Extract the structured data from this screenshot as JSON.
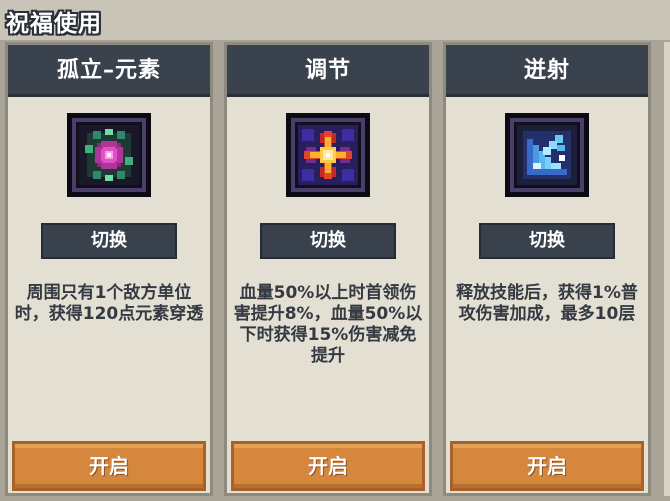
{
  "header": {
    "title": "祝福使用"
  },
  "cards": [
    {
      "title": "孤立–元素",
      "icon": "green-magenta-orb-icon",
      "switch_label": "切换",
      "description": "周围只有1个敌方单位时，获得120点元素穿透",
      "open_label": "开启"
    },
    {
      "title": "调节",
      "icon": "golden-star-burst-icon",
      "switch_label": "切换",
      "description": "血量50%以上时首领伤害提升8%，血量50%以下时获得15%伤害减免提升",
      "open_label": "开启"
    },
    {
      "title": "迸射",
      "icon": "cyan-shard-icon",
      "switch_label": "切换",
      "description": "释放技能后，获得1%普攻伤害加成，最多10层",
      "open_label": "开启"
    }
  ],
  "colors": {
    "panel_bg": "#e4dfd3",
    "header_bar": "#39424d",
    "open_button": "#d5873d",
    "text_dark": "#343a42"
  }
}
